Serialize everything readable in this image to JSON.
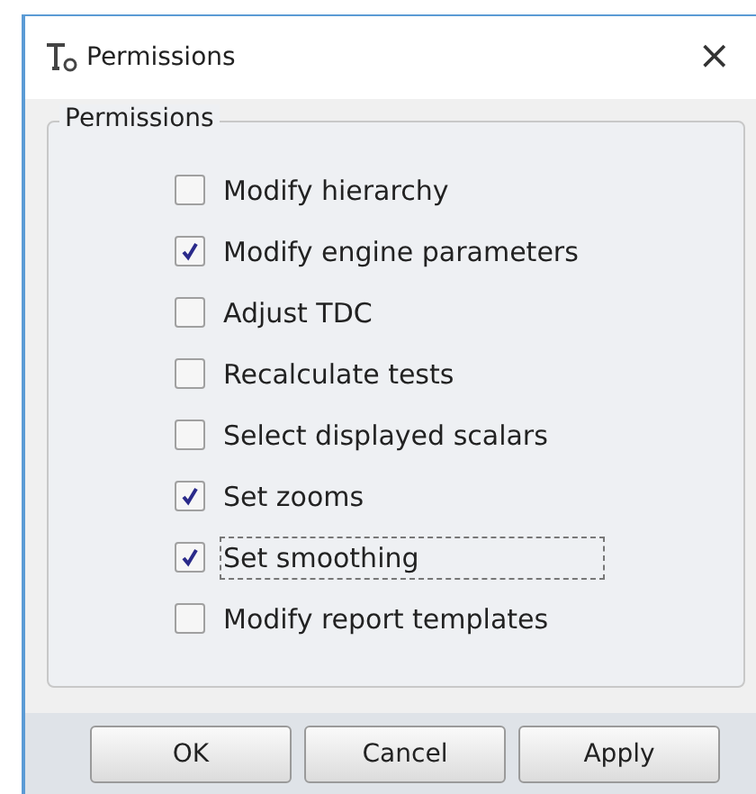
{
  "window": {
    "title": "Permissions",
    "close": "×"
  },
  "group": {
    "title": "Permissions",
    "items": [
      {
        "label": "Modify hierarchy",
        "checked": false,
        "focused": false
      },
      {
        "label": "Modify engine parameters",
        "checked": true,
        "focused": false
      },
      {
        "label": "Adjust TDC",
        "checked": false,
        "focused": false
      },
      {
        "label": "Recalculate tests",
        "checked": false,
        "focused": false
      },
      {
        "label": "Select displayed scalars",
        "checked": false,
        "focused": false
      },
      {
        "label": "Set zooms",
        "checked": true,
        "focused": false
      },
      {
        "label": "Set smoothing",
        "checked": true,
        "focused": true
      },
      {
        "label": "Modify report templates",
        "checked": false,
        "focused": false
      }
    ]
  },
  "buttons": [
    "OK",
    "Cancel",
    "Apply"
  ]
}
